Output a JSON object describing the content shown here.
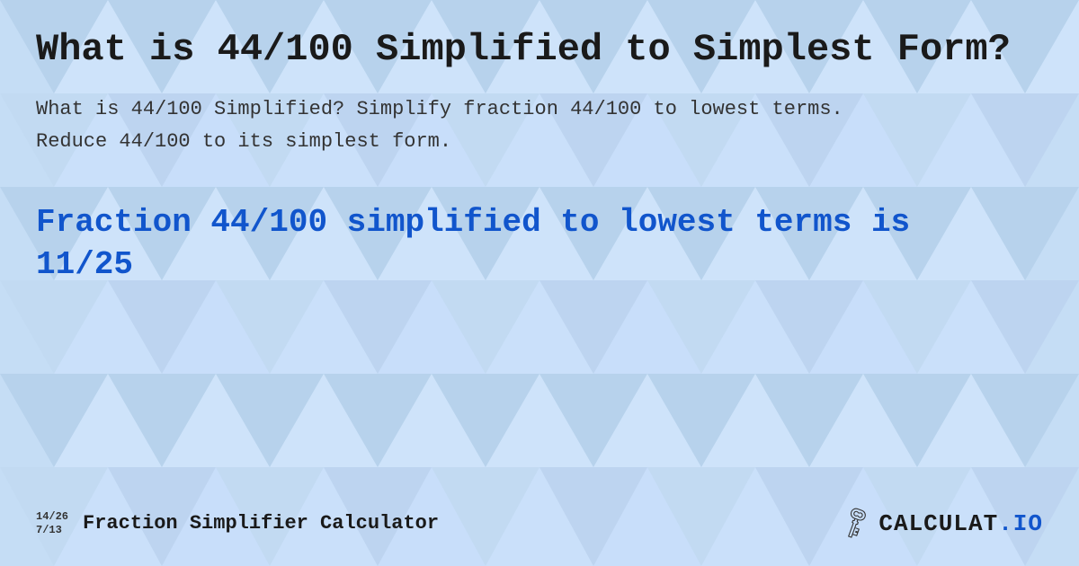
{
  "background": {
    "color": "#c8dff5",
    "pattern": "triangles"
  },
  "main_title": "What is 44/100 Simplified to Simplest Form?",
  "description": "What is 44/100 Simplified? Simplify fraction 44/100 to lowest terms. Reduce 44/100 to its simplest form.",
  "result": {
    "text": "Fraction 44/100 simplified to lowest terms is 11/25"
  },
  "footer": {
    "fraction1": "14/26",
    "fraction2": "7/13",
    "site_title": "Fraction Simplifier Calculator",
    "logo_icon": "🗝",
    "logo_text_before_dot": "CALCULAT",
    "logo_text_dot": ".",
    "logo_text_after_dot": "IO"
  }
}
